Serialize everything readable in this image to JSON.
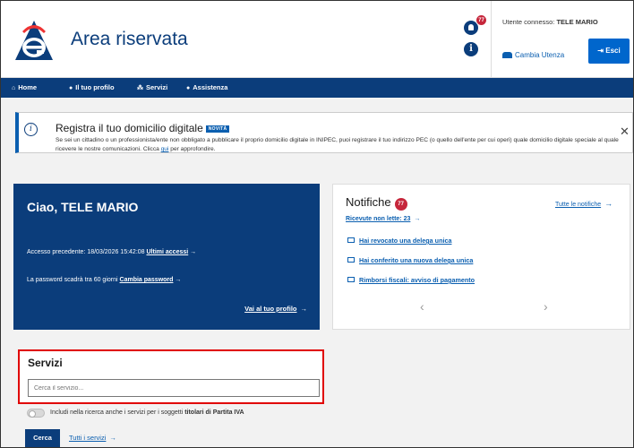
{
  "header": {
    "app_title": "Area riservata",
    "notifications_count": "77",
    "user_label": "Utente connesso:",
    "user_name": "TELE MARIO",
    "switch_user": "Cambia Utenza",
    "exit": "Esci"
  },
  "nav": {
    "items": [
      {
        "label": "Home",
        "icon": "home-icon"
      },
      {
        "label": "Il tuo profilo",
        "icon": "user-icon"
      },
      {
        "label": "Servizi",
        "icon": "services-icon"
      },
      {
        "label": "Assistenza",
        "icon": "help-icon"
      }
    ]
  },
  "banner": {
    "title": "Registra il tuo domicilio digitale",
    "badge": "NOVITÀ",
    "text_before_link": "Se sei un cittadino o un professionista/ente non obbligato a pubblicare il proprio domicilio digitale in INIPEC, puoi registrare il tuo indirizzo PEC (o quello dell'ente per cui operi) quale domicilio digitale speciale al quale ricevere le nostre comunicazioni. Clicca ",
    "link": "qui",
    "text_after_link": " per approfondire."
  },
  "greeting": {
    "title": "Ciao, TELE MARIO",
    "last_access": "Accesso precedente: 18/03/2026 15:42:08",
    "last_access_link": "Ultimi accessi",
    "password_expiry": "La password scadrà tra 60 giorni",
    "password_link": "Cambia password",
    "profile_link": "Vai al tuo profilo"
  },
  "notifications": {
    "title": "Notifiche",
    "count": "77",
    "all_link": "Tutte le notifiche",
    "unread": "Ricevute non lette: 23",
    "items": [
      "Hai revocato una delega unica",
      "Hai conferito una nuova delega unica",
      "Rimborsi fiscali: avviso di pagamento"
    ]
  },
  "services": {
    "title": "Servizi",
    "search_placeholder": "Cerca il servizio...",
    "toggle_label_prefix": "Includi nella ricerca anche i servizi per i soggetti ",
    "toggle_label_bold": "titolari di Partita IVA",
    "search_button": "Cerca",
    "all_services": "Tutti i servizi"
  },
  "colors": {
    "primary": "#0b3d7b",
    "link": "#0b5fb0",
    "badge": "#c6263b",
    "highlight": "#e00000"
  }
}
